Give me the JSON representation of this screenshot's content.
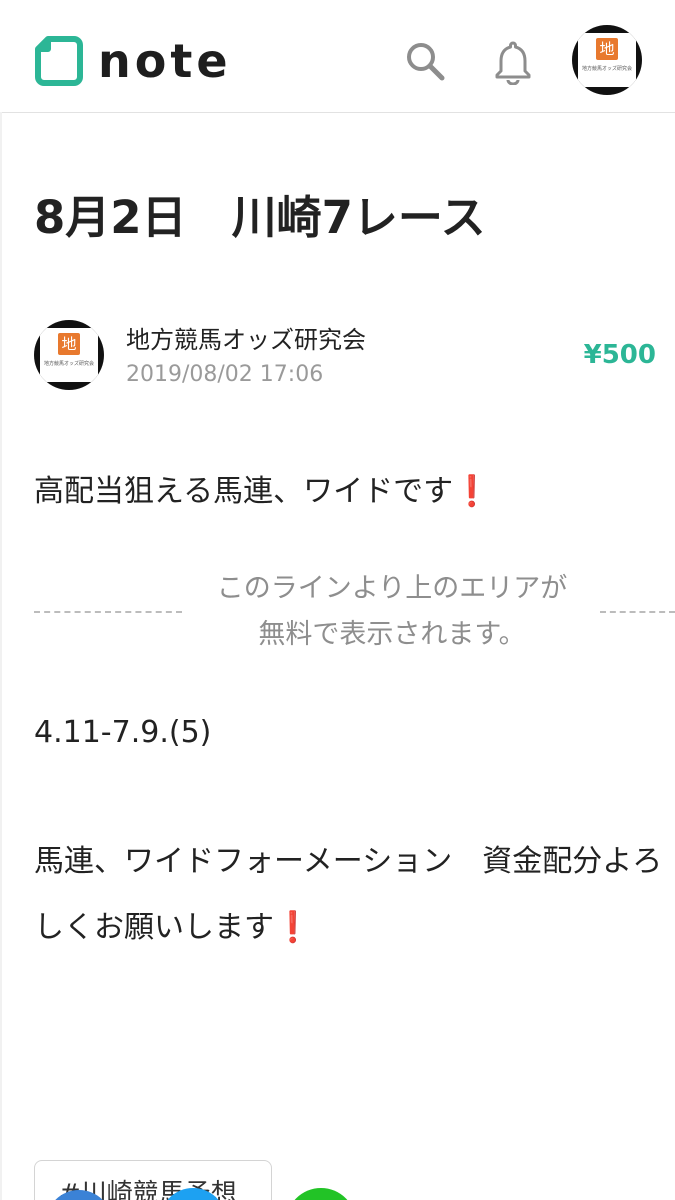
{
  "header": {
    "logo_text": "note",
    "search_icon": "search-icon",
    "notification_icon": "bell-icon"
  },
  "avatar": {
    "mark": "地",
    "caption": "地方競馬オッズ研究会"
  },
  "article": {
    "title": "8月2日　川崎7レース",
    "author": "地方競馬オッズ研究会",
    "date": "2019/08/02 17:06",
    "price": "¥500",
    "intro": "高配当狙える馬連、ワイドです",
    "intro_emoji": "❗",
    "free_line_1": "このラインより上のエリアが",
    "free_line_2": "無料で表示されます。",
    "paid_line_1": "4.11-7.9.(5)",
    "paid_line_2": "馬連、ワイドフォーメーション　資金配分よろ",
    "paid_line_3": "しくお願いします",
    "paid_line_3_emoji": "❗"
  },
  "tags": [
    "#川崎競馬予想"
  ],
  "colors": {
    "accent": "#2cb696",
    "exclamation": "#e0242a",
    "muted": "#9a9a9a"
  }
}
